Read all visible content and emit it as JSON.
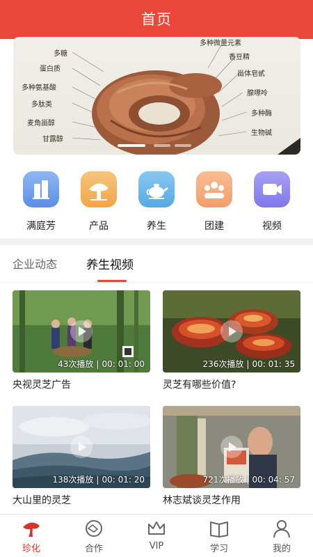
{
  "header": {
    "title": "首页"
  },
  "banner": {
    "left_labels": [
      "多糖",
      "蛋白质",
      "多种氨基酸",
      "多肽类",
      "麦角甾醇",
      "甘露醇"
    ],
    "right_labels": [
      "多种微量元素",
      "香豆精",
      "甾体皂甙",
      "腺嘌呤",
      "多种酶",
      "生物碱"
    ]
  },
  "quick_nav": [
    {
      "label": "满庭芳",
      "icon": "building-icon",
      "color": "#5b8fe6"
    },
    {
      "label": "产品",
      "icon": "mushroom-icon",
      "color": "#f1a54a"
    },
    {
      "label": "养生",
      "icon": "teapot-icon",
      "color": "#56a9e4"
    },
    {
      "label": "团建",
      "icon": "group-icon",
      "color": "#f59d6b"
    },
    {
      "label": "视频",
      "icon": "video-camera-icon",
      "color": "#8177ea"
    }
  ],
  "tabs": [
    {
      "label": "企业动态",
      "active": false
    },
    {
      "label": "养生视频",
      "active": true
    }
  ],
  "videos": [
    {
      "title": "央视灵芝广告",
      "plays": "43次播放",
      "duration": "00: 01: 00"
    },
    {
      "title": "灵芝有哪些价值?",
      "plays": "236次播放",
      "duration": "00: 01: 35"
    },
    {
      "title": "大山里的灵芝",
      "plays": "138次播放",
      "duration": "00: 01: 20"
    },
    {
      "title": "林志斌谈灵芝作用",
      "plays": "721次播放",
      "duration": "00: 04: 57"
    }
  ],
  "bottom_nav": [
    {
      "label": "珍化",
      "icon": "lingzhi-icon",
      "active": true
    },
    {
      "label": "合作",
      "icon": "handshake-icon",
      "active": false
    },
    {
      "label": "VIP",
      "icon": "crown-icon",
      "active": false
    },
    {
      "label": "学习",
      "icon": "book-icon",
      "active": false
    },
    {
      "label": "我的",
      "icon": "user-icon",
      "active": false
    }
  ],
  "colors": {
    "primary": "#e9473a",
    "active_nav": "#d8332a"
  }
}
